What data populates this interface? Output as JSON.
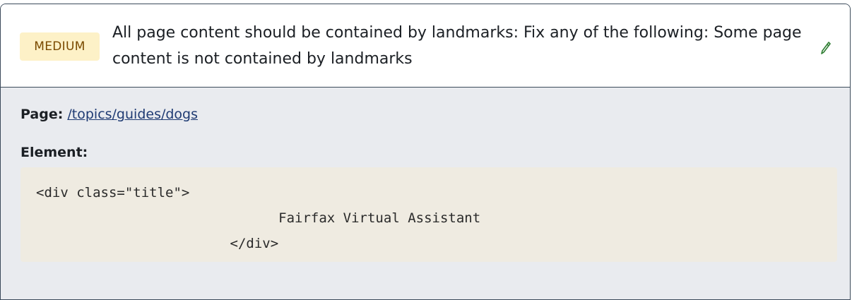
{
  "issue": {
    "severity": "MEDIUM",
    "title": "All page content should be contained by landmarks: Fix any of the following: Some page content is not contained by landmarks",
    "edit_icon": "pencil-icon",
    "colors": {
      "badge_bg": "#fdf1c7",
      "badge_text": "#7a4a00",
      "link": "#1f3b73",
      "code_bg": "#efebe1",
      "details_bg": "#e9ebef"
    }
  },
  "details": {
    "page_label": "Page:",
    "page_link": "/topics/guides/dogs",
    "element_label": "Element:",
    "element_code": "<div class=\"title\">\n                              Fairfax Virtual Assistant\n                        </div>"
  }
}
